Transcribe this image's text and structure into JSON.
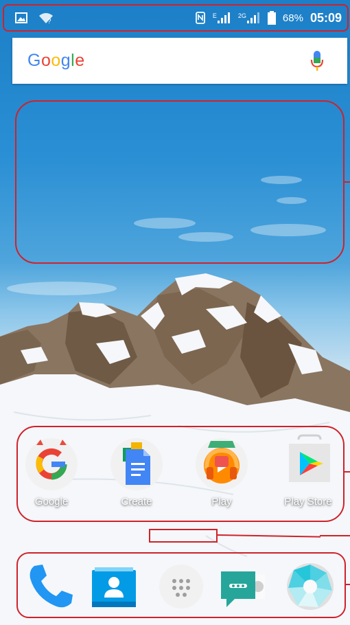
{
  "status_bar": {
    "icons": [
      "image-icon",
      "wifi-question-icon",
      "nfc-icon",
      "signal-edge-icon",
      "signal-2g-icon",
      "battery-icon"
    ],
    "signal1_label": "E",
    "signal2_label": "2G",
    "battery": "68%",
    "time": "05:09"
  },
  "search": {
    "logo": "Google",
    "logo_letters": [
      {
        "ch": "G",
        "color": "#4285F4"
      },
      {
        "ch": "o",
        "color": "#EA4335"
      },
      {
        "ch": "o",
        "color": "#FBBC05"
      },
      {
        "ch": "g",
        "color": "#4285F4"
      },
      {
        "ch": "l",
        "color": "#34A853"
      },
      {
        "ch": "e",
        "color": "#EA4335"
      }
    ],
    "mic_icon": "mic-icon"
  },
  "apps": [
    {
      "label": "Google",
      "icon": "google-icon"
    },
    {
      "label": "Create",
      "icon": "docs-create-icon"
    },
    {
      "label": "Play",
      "icon": "play-music-icon"
    },
    {
      "label": "Play Store",
      "icon": "play-store-icon"
    }
  ],
  "dock": [
    {
      "icon": "phone-icon"
    },
    {
      "icon": "contacts-icon"
    },
    {
      "icon": "app-drawer-icon"
    },
    {
      "icon": "messages-icon"
    },
    {
      "icon": "camera-icon"
    }
  ]
}
